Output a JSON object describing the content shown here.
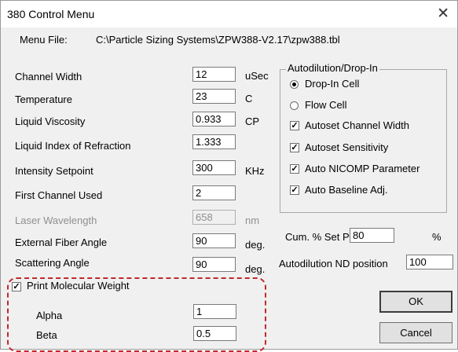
{
  "window": {
    "title": "380  Control Menu",
    "close_glyph": "✕"
  },
  "menu_file": {
    "label": "Menu File:",
    "path": "C:\\Particle Sizing Systems\\ZPW388-V2.17\\zpw388.tbl"
  },
  "params": [
    {
      "label": "Channel Width",
      "value": "12",
      "unit": "uSec"
    },
    {
      "label": "Temperature",
      "value": "23",
      "unit": "C"
    },
    {
      "label": "Liquid Viscosity",
      "value": "0.933",
      "unit": "CP"
    },
    {
      "label": "Liquid Index of Refraction",
      "value": "1.333",
      "unit": ""
    },
    {
      "label": "Intensity Setpoint",
      "value": "300",
      "unit": "KHz"
    },
    {
      "label": "First Channel Used",
      "value": "2",
      "unit": ""
    },
    {
      "label": "Laser Wavelength",
      "value": "658",
      "unit": "nm",
      "disabled": true
    },
    {
      "label": "External Fiber Angle",
      "value": "90",
      "unit": "deg."
    },
    {
      "label": "Scattering Angle",
      "value": "90",
      "unit": "deg."
    }
  ],
  "autodilution": {
    "title": "Autodilution/Drop-In",
    "radios": [
      {
        "label": "Drop-In Cell",
        "selected": true
      },
      {
        "label": "Flow Cell",
        "selected": false
      }
    ],
    "checks": [
      {
        "label": "Autoset Channel Width",
        "checked": true
      },
      {
        "label": "Autoset Sensitivity",
        "checked": true
      },
      {
        "label": "Auto NICOMP Parameter",
        "checked": true
      },
      {
        "label": "Auto Baseline Adj.",
        "checked": true
      }
    ]
  },
  "cum_set": {
    "label": "Cum. % Set Pt.",
    "value": "80",
    "unit": "%"
  },
  "nd_position": {
    "label": "Autodilution ND position",
    "value": "100"
  },
  "molecular": {
    "label": "Print Molecular Weight",
    "checked": true,
    "alpha_label": "Alpha",
    "alpha_value": "1",
    "beta_label": "Beta",
    "beta_value": "0.5"
  },
  "buttons": {
    "ok": "OK",
    "cancel": "Cancel"
  },
  "highlight_color": "#c0282e"
}
